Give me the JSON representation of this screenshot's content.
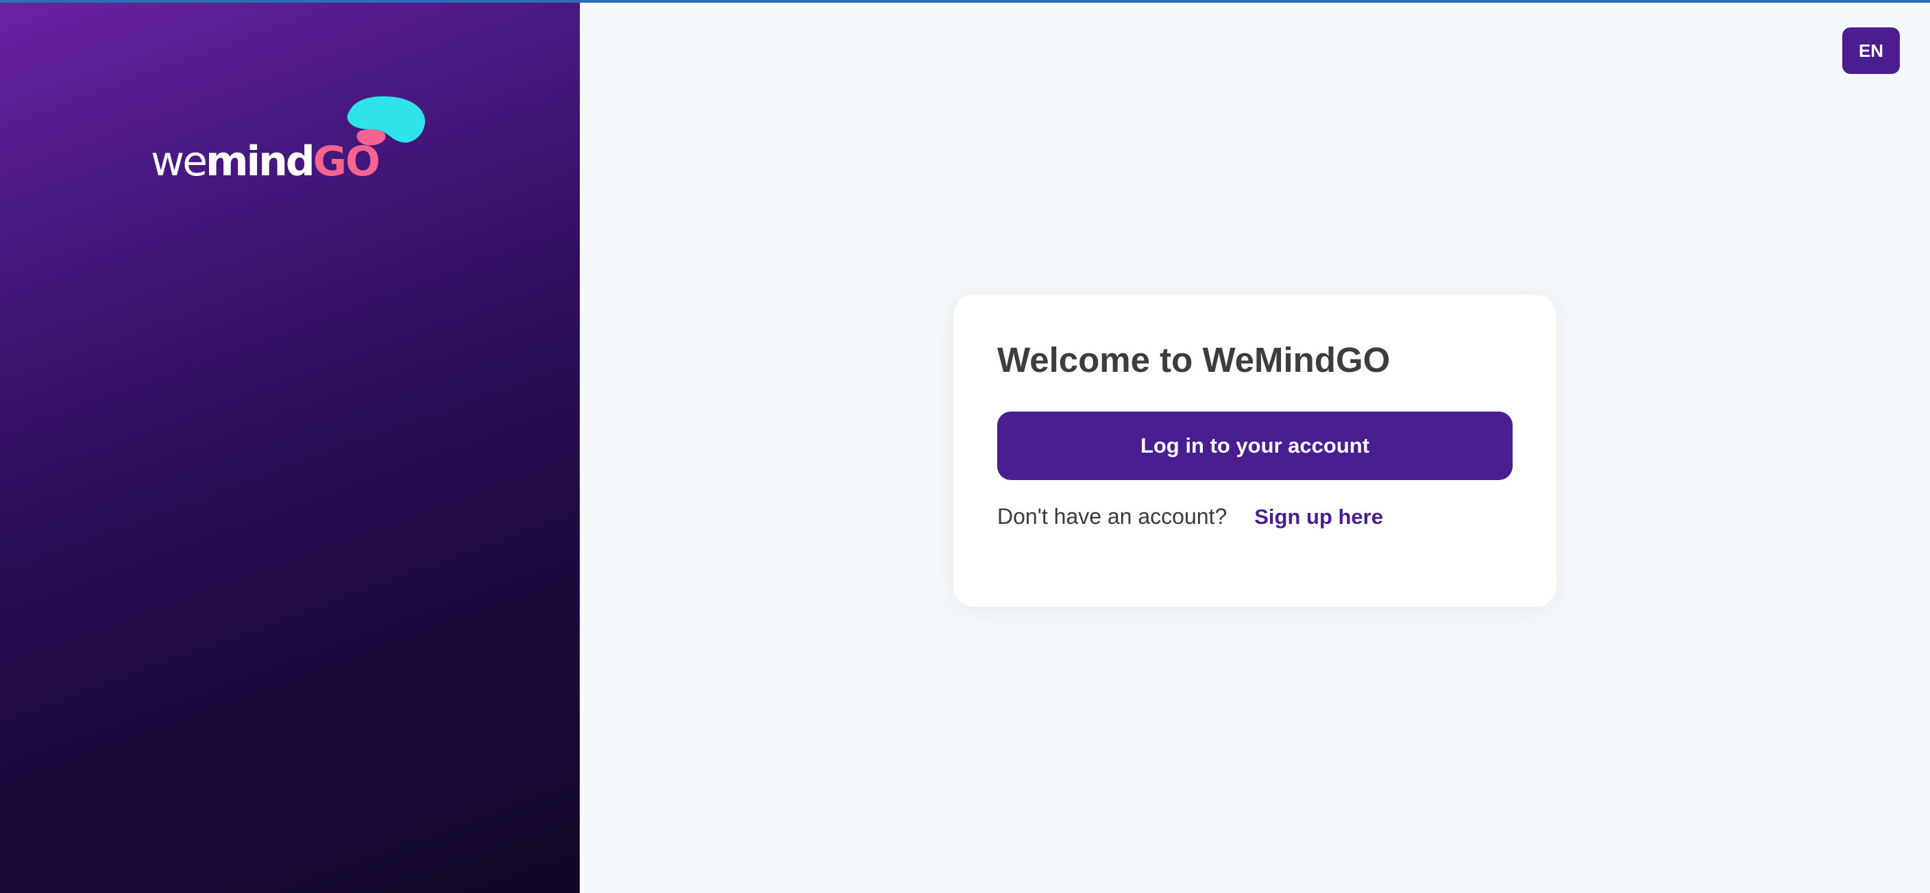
{
  "brand": {
    "logo_we": "we",
    "logo_mind": "mind",
    "logo_go": "GO"
  },
  "header": {
    "language": "EN"
  },
  "card": {
    "title": "Welcome to WeMindGO",
    "login_label": "Log in to your account",
    "signup_prompt": "Don't have an account?",
    "signup_link": "Sign up here"
  },
  "colors": {
    "primary": "#4a1d90",
    "logo_accent_pink": "#f7638f",
    "logo_accent_cyan": "#2ee3ea",
    "background": "#f5f9fc"
  }
}
